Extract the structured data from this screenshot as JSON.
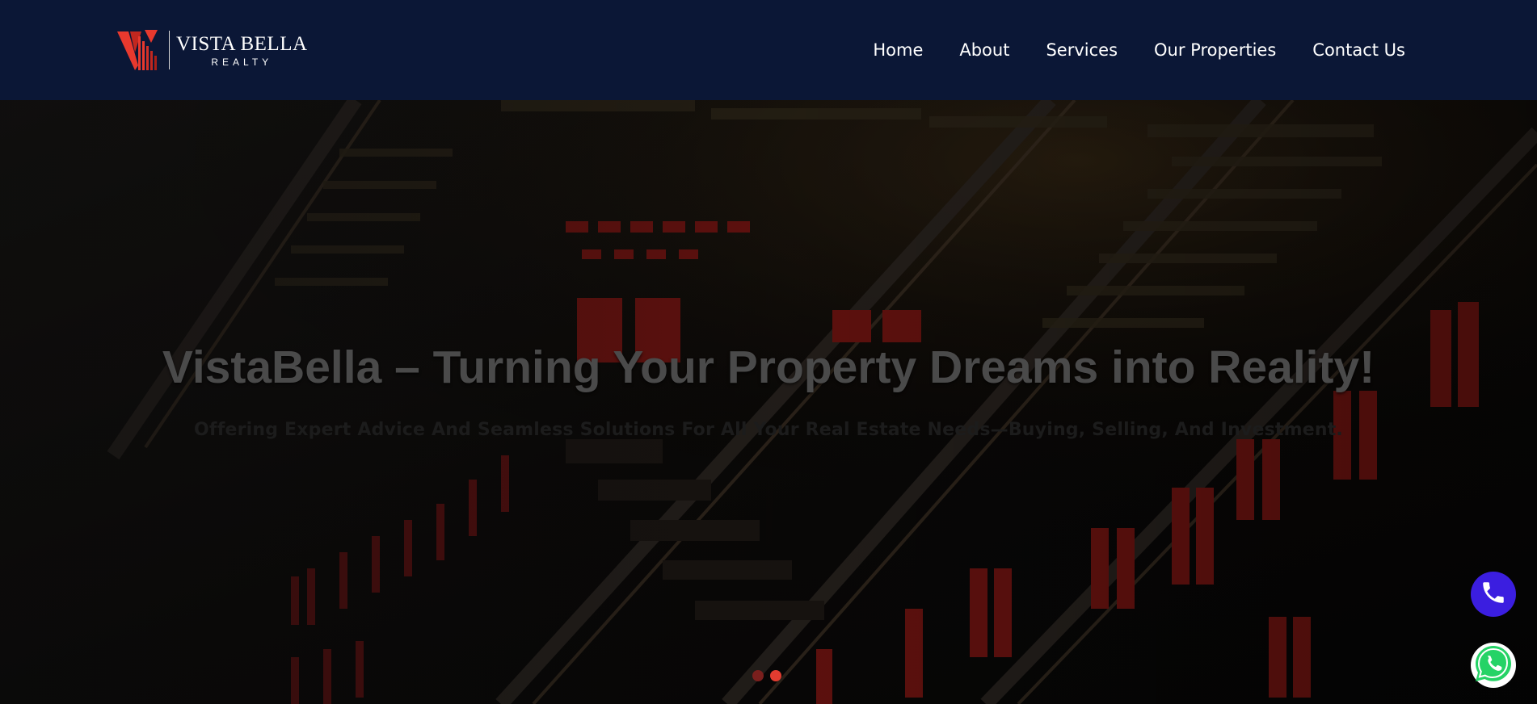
{
  "brand": {
    "name": "VISTA BELLA",
    "tagline": "REALTY",
    "accent_color": "#e8392e",
    "header_color": "#0b1736"
  },
  "nav": {
    "items": [
      {
        "label": "Home"
      },
      {
        "label": "About"
      },
      {
        "label": "Services"
      },
      {
        "label": "Our Properties"
      },
      {
        "label": "Contact Us"
      }
    ]
  },
  "hero": {
    "title": "VistaBella – Turning Your Property Dreams into Reality!",
    "subtitle": "Offering Expert Advice And Seamless Solutions For All Your Real Estate Needs—Buying, Selling, And Investment.",
    "slides": {
      "count": 2,
      "active_index": 1
    }
  },
  "floating": {
    "phone_icon": "phone-icon",
    "whatsapp_icon": "whatsapp-icon",
    "phone_color": "#3b1ee0",
    "whatsapp_color": "#25d366"
  }
}
